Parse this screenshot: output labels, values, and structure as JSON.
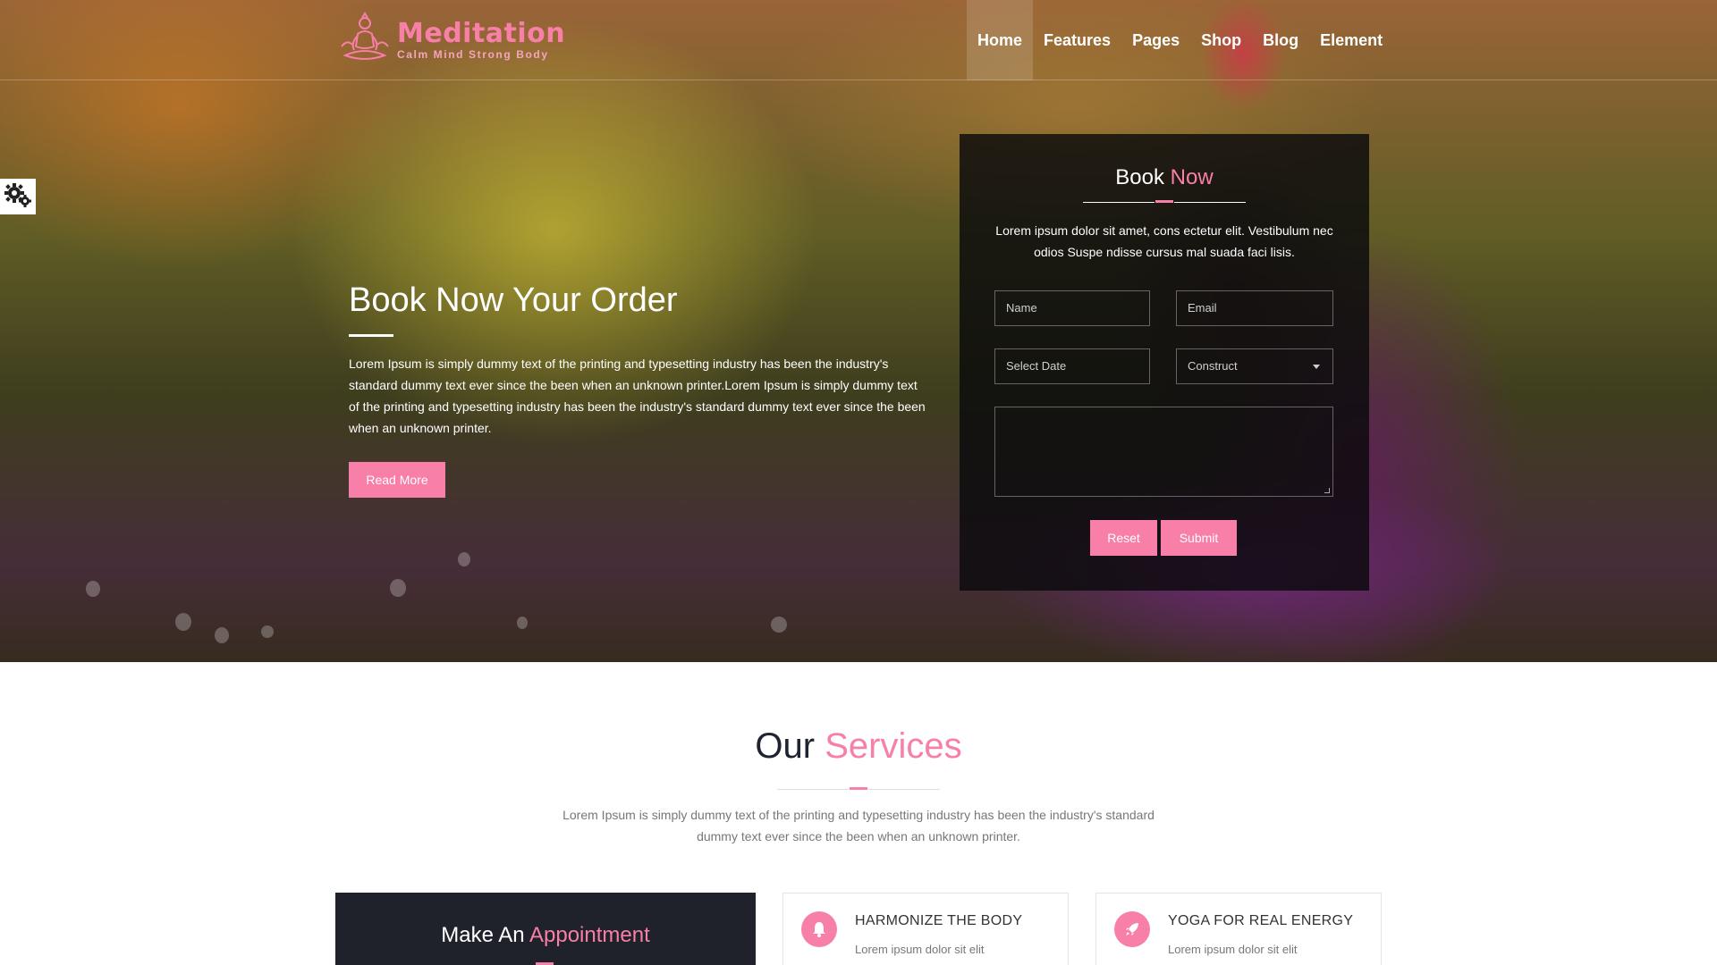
{
  "header": {
    "logo_title": "Meditation",
    "logo_tagline": "Calm Mind Strong Body",
    "nav": [
      "Home",
      "Features",
      "Pages",
      "Shop",
      "Blog",
      "Element"
    ],
    "active_nav": "Home"
  },
  "hero": {
    "title": "Book Now Your Order",
    "text": "Lorem Ipsum is simply dummy text of the printing and typesetting industry has been the industry's standard dummy text ever since the been when an unknown printer.Lorem Ipsum is simply dummy text of the printing and typesetting industry has been the industry's standard dummy text ever since the been when an unknown printer.",
    "button": "Read More"
  },
  "booking": {
    "title_a": "Book",
    "title_b": "Now",
    "description": "Lorem ipsum dolor sit amet, cons ectetur elit. Vestibulum nec odios Suspe ndisse cursus mal suada faci lisis.",
    "name_placeholder": "Name",
    "email_placeholder": "Email",
    "date_placeholder": "Select Date",
    "select_value": "Construct",
    "reset_label": "Reset",
    "submit_label": "Submit"
  },
  "services": {
    "title_a": "Our",
    "title_b": "Services",
    "description": "Lorem Ipsum is simply dummy text of the printing and typesetting industry has been the industry's standard dummy text ever since the been when an unknown printer.",
    "appointment_a": "Make An",
    "appointment_b": "Appointment",
    "cards": [
      {
        "title": "HARMONIZE THE BODY",
        "text": "Lorem ipsum dolor sit elit",
        "icon": "bell-icon"
      },
      {
        "title": "YOGA FOR REAL ENERGY",
        "text": "Lorem ipsum dolor sit elit",
        "icon": "rocket-icon"
      }
    ]
  },
  "colors": {
    "accent": "#f77fa8",
    "dark": "#1f222b"
  }
}
